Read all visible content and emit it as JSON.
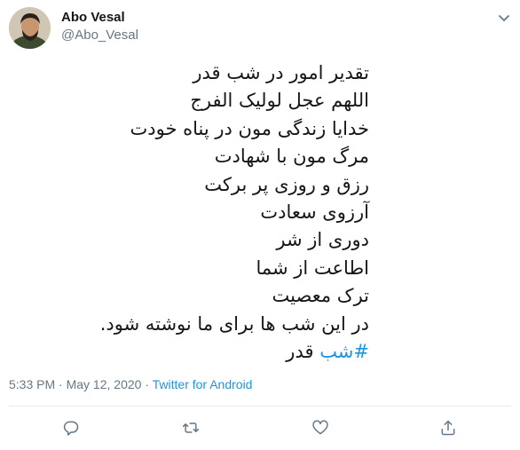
{
  "author": {
    "display_name": "Abo Vesal",
    "handle": "@Abo_Vesal"
  },
  "tweet": {
    "lines": [
      "تقدیر امور در شب قدر",
      "اللهم عجل لولیک الفرج",
      "خدایا زندگی مون در پناه خودت",
      "مرگ مون با شهادت",
      "رزق و روزی پر برکت",
      "آرزوی سعادت",
      "دوری از شر",
      "اطاعت از شما",
      "ترک معصیت",
      "در این شب ها برای ما نوشته شود."
    ],
    "hashtag": "#شب",
    "hashtag_suffix": " قدر"
  },
  "meta": {
    "time": "5:33 PM",
    "separator1": " · ",
    "date": "May 12, 2020",
    "separator2": " · ",
    "source": "Twitter for Android"
  },
  "actions": {
    "reply": "reply-icon",
    "retweet": "retweet-icon",
    "like": "heart-icon",
    "share": "share-icon"
  },
  "colors": {
    "link": "#1b95e0",
    "secondary_text": "#657786",
    "icon": "#657786",
    "divider": "#e6ecf0"
  }
}
